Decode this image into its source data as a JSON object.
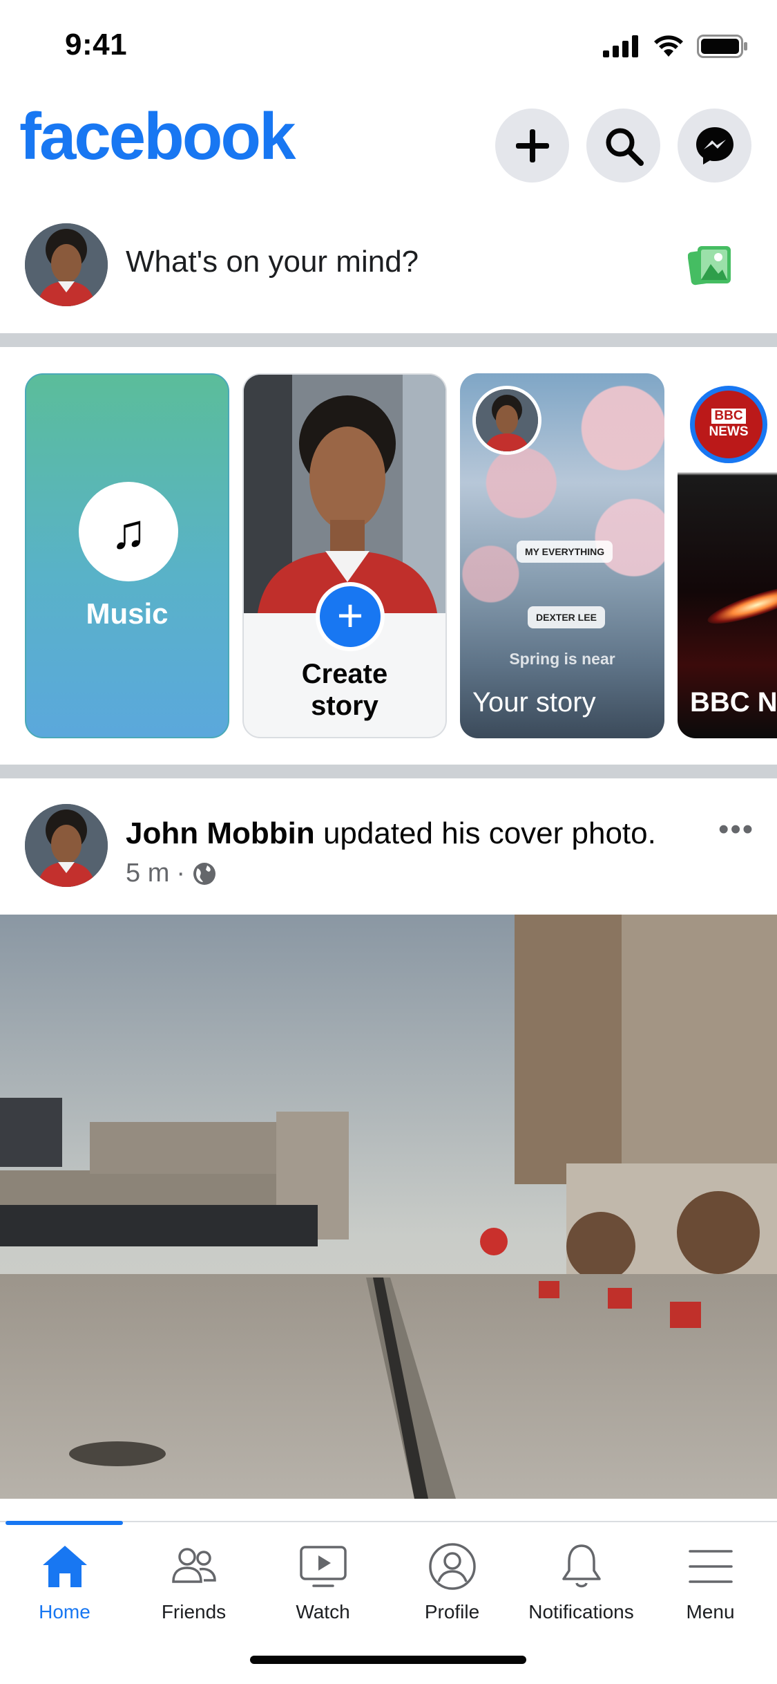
{
  "status_bar": {
    "time": "9:41"
  },
  "header": {
    "logo": "facebook",
    "buttons": [
      {
        "name": "add-button",
        "icon": "plus-icon"
      },
      {
        "name": "search-button",
        "icon": "search-icon"
      },
      {
        "name": "messenger-button",
        "icon": "messenger-icon"
      }
    ]
  },
  "composer": {
    "placeholder": "What's on your mind?",
    "photo_icon": "photo-icon"
  },
  "stories": {
    "music": {
      "label": "Music",
      "icon": "music-note-icon"
    },
    "create": {
      "label_line1": "Create",
      "label_line2": "story"
    },
    "your_story": {
      "label": "Your story",
      "sticker_song": "MY EVERYTHING",
      "sticker_artist": "DEXTER LEE",
      "overlay_text": "Spring is near"
    },
    "bbc": {
      "badge_line1": "BBC",
      "badge_line2": "NEWS",
      "label": "BBC Ne"
    }
  },
  "post": {
    "author": "John Mobbin",
    "action": "updated his cover photo.",
    "time": "5 m",
    "audience_icon": "globe-icon",
    "more_label": "•••"
  },
  "tabs": [
    {
      "label": "Home",
      "icon": "home-icon",
      "active": true
    },
    {
      "label": "Friends",
      "icon": "friends-icon",
      "active": false
    },
    {
      "label": "Watch",
      "icon": "watch-icon",
      "active": false
    },
    {
      "label": "Profile",
      "icon": "profile-icon",
      "active": false
    },
    {
      "label": "Notifications",
      "icon": "bell-icon",
      "active": false
    },
    {
      "label": "Menu",
      "icon": "menu-icon",
      "active": false
    }
  ],
  "colors": {
    "brand": "#1877f2",
    "divider": "#cdd1d5",
    "secondary_text": "#65676b"
  }
}
